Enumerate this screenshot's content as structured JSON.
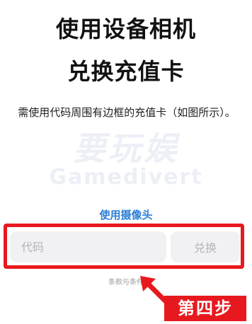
{
  "header": {
    "title_line1": "使用设备相机",
    "title_line2": "兑换充值卡"
  },
  "description": "需使用代码周围有边框的充值卡（如图所示）。",
  "watermark": {
    "line1": "要玩娱",
    "line2": "Gamedivert"
  },
  "camera_link": "使用摄像头",
  "redeem": {
    "code_placeholder": "代码",
    "code_value": "",
    "button_label": "兑换"
  },
  "terms_link": "条款与条件",
  "annotation": {
    "step_label": "第四步",
    "highlight_color": "#e8191e"
  },
  "colors": {
    "link": "#2b7fd6",
    "field_bg": "#f1f1f3",
    "placeholder": "#b5b5ba"
  }
}
